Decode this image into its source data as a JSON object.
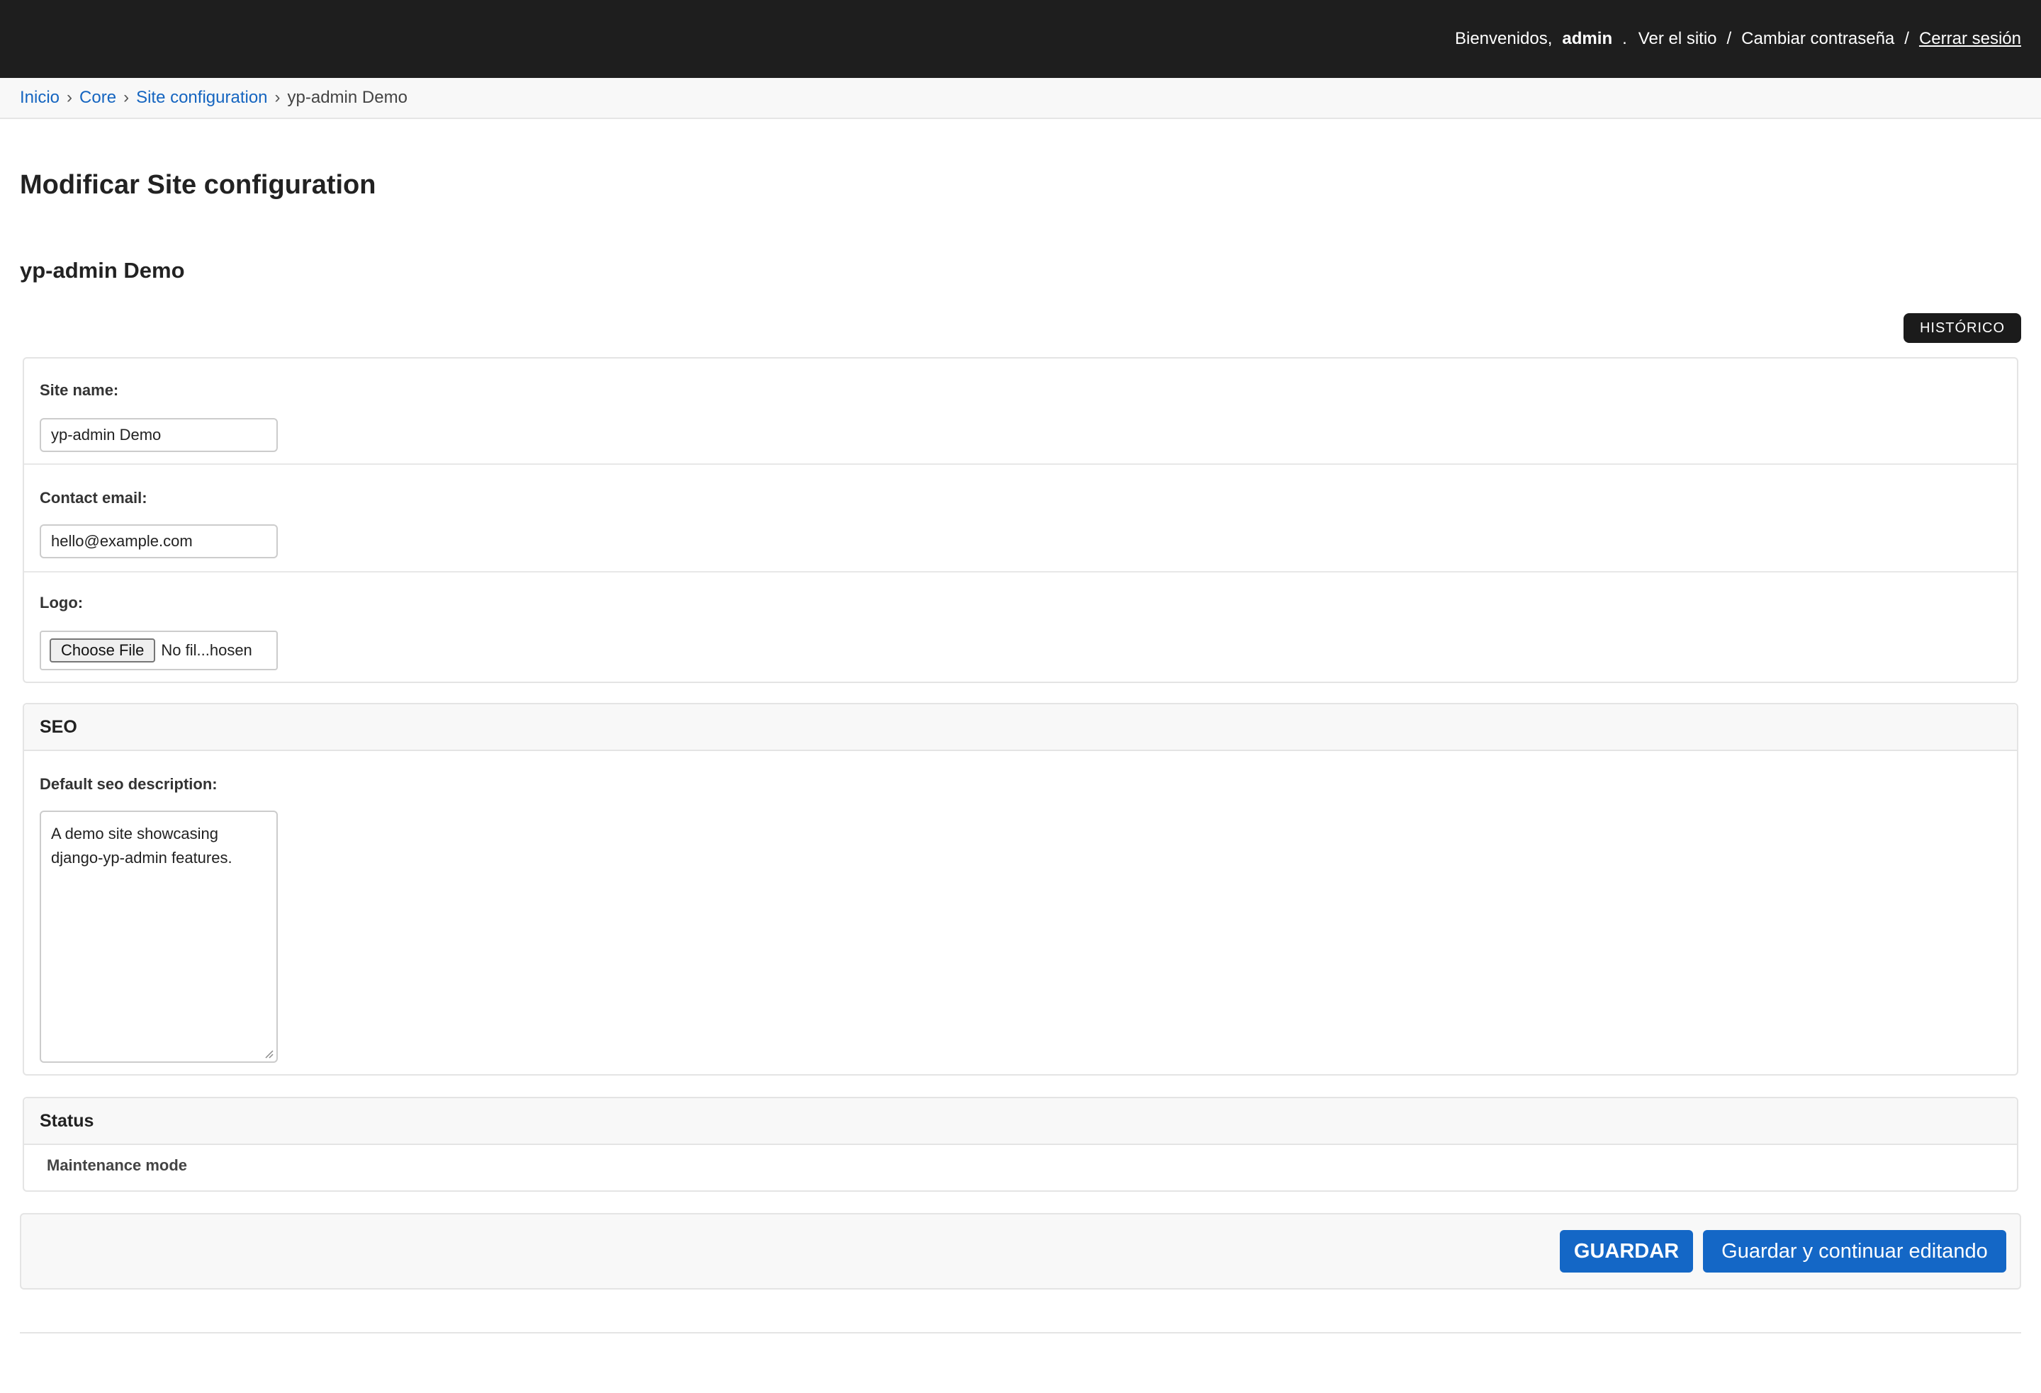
{
  "header": {
    "welcome": "Bienvenidos,",
    "username": "admin",
    "dot": ".",
    "view_site": "Ver el sitio",
    "separator": "/",
    "change_password": "Cambiar contraseña",
    "logout": "Cerrar sesión"
  },
  "breadcrumbs": {
    "home": "Inicio",
    "app": "Core",
    "model": "Site configuration",
    "current": "yp-admin Demo",
    "arrow": "›"
  },
  "page_title": "Modificar Site configuration",
  "object_title": "yp-admin Demo",
  "history_label": "HISTÓRICO",
  "form": {
    "site_name": {
      "label": "Site name:",
      "value": "yp-admin Demo"
    },
    "contact_email": {
      "label": "Contact email:",
      "value": "hello@example.com"
    },
    "logo": {
      "label": "Logo:",
      "button": "Choose File",
      "status": "No fil...hosen"
    }
  },
  "seo": {
    "header": "SEO",
    "description_label": "Default seo description:",
    "description_value": "A demo site showcasing django-yp-admin features."
  },
  "status": {
    "header": "Status",
    "maintenance_label": "Maintenance mode"
  },
  "actions": {
    "save": "GUARDAR",
    "save_continue": "Guardar y continuar editando"
  },
  "colors": {
    "header_bg": "#1e1e1e",
    "link": "#1565c0",
    "primary_button": "#1467c6"
  }
}
